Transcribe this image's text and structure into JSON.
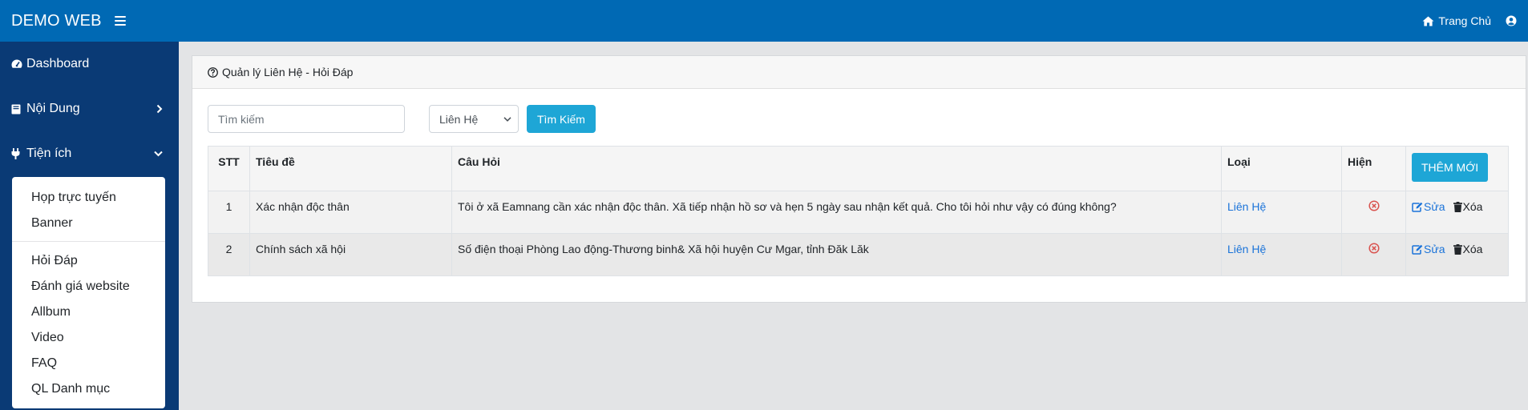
{
  "app": {
    "brand": "DEMO WEB",
    "home_label": "Trang Chủ"
  },
  "sidebar": {
    "items": [
      {
        "label": "Dashboard"
      },
      {
        "label": "Nội Dung"
      },
      {
        "label": "Tiện ích"
      }
    ],
    "submenu": {
      "group1": [
        "Họp trực tuyến",
        "Banner"
      ],
      "group2": [
        "Hỏi Đáp",
        "Đánh giá website",
        "Allbum",
        "Video",
        "FAQ",
        "QL Danh mục"
      ]
    }
  },
  "page": {
    "title": "Quản lý Liên Hệ - Hỏi Đáp",
    "search_placeholder": "Tìm kiếm",
    "select_value": "Liên Hệ",
    "search_button": "Tìm Kiếm",
    "add_button": "THÊM MỚI"
  },
  "table": {
    "headers": [
      "STT",
      "Tiêu đề",
      "Câu Hỏi",
      "Loại",
      "Hiện"
    ],
    "rows": [
      {
        "stt": "1",
        "title": "Xác nhận độc thân",
        "question": "Tôi ở xã Eamnang cần xác nhận độc thân. Xã tiếp nhận hồ sơ và hẹn 5 ngày sau nhận kết quả. Cho tôi hỏi như vậy có đúng không?",
        "type": "Liên Hệ",
        "edit": "Sửa",
        "delete": "Xóa"
      },
      {
        "stt": "2",
        "title": "Chính sách xã hội",
        "question": "Số điện thoại Phòng Lao động-Thương binh& Xã hội huyện Cư Mgar, tỉnh Đăk Lăk",
        "type": "Liên Hệ",
        "edit": "Sửa",
        "delete": "Xóa"
      }
    ]
  },
  "colors": {
    "topbar": "#0069b4",
    "sidebar": "#0a3a75",
    "accent_button": "#1ea6d6",
    "link": "#1a73d9",
    "hidden_status": "#d9534f"
  },
  "icons": {
    "menu": "hamburger-icon",
    "home": "home-icon",
    "user": "user-circle-icon",
    "dashboard": "tachometer-icon",
    "content": "book-icon",
    "utility": "plug-icon",
    "header": "question-circle-icon",
    "hidden": "times-circle-icon",
    "edit": "edit-icon",
    "delete": "trash-icon"
  }
}
